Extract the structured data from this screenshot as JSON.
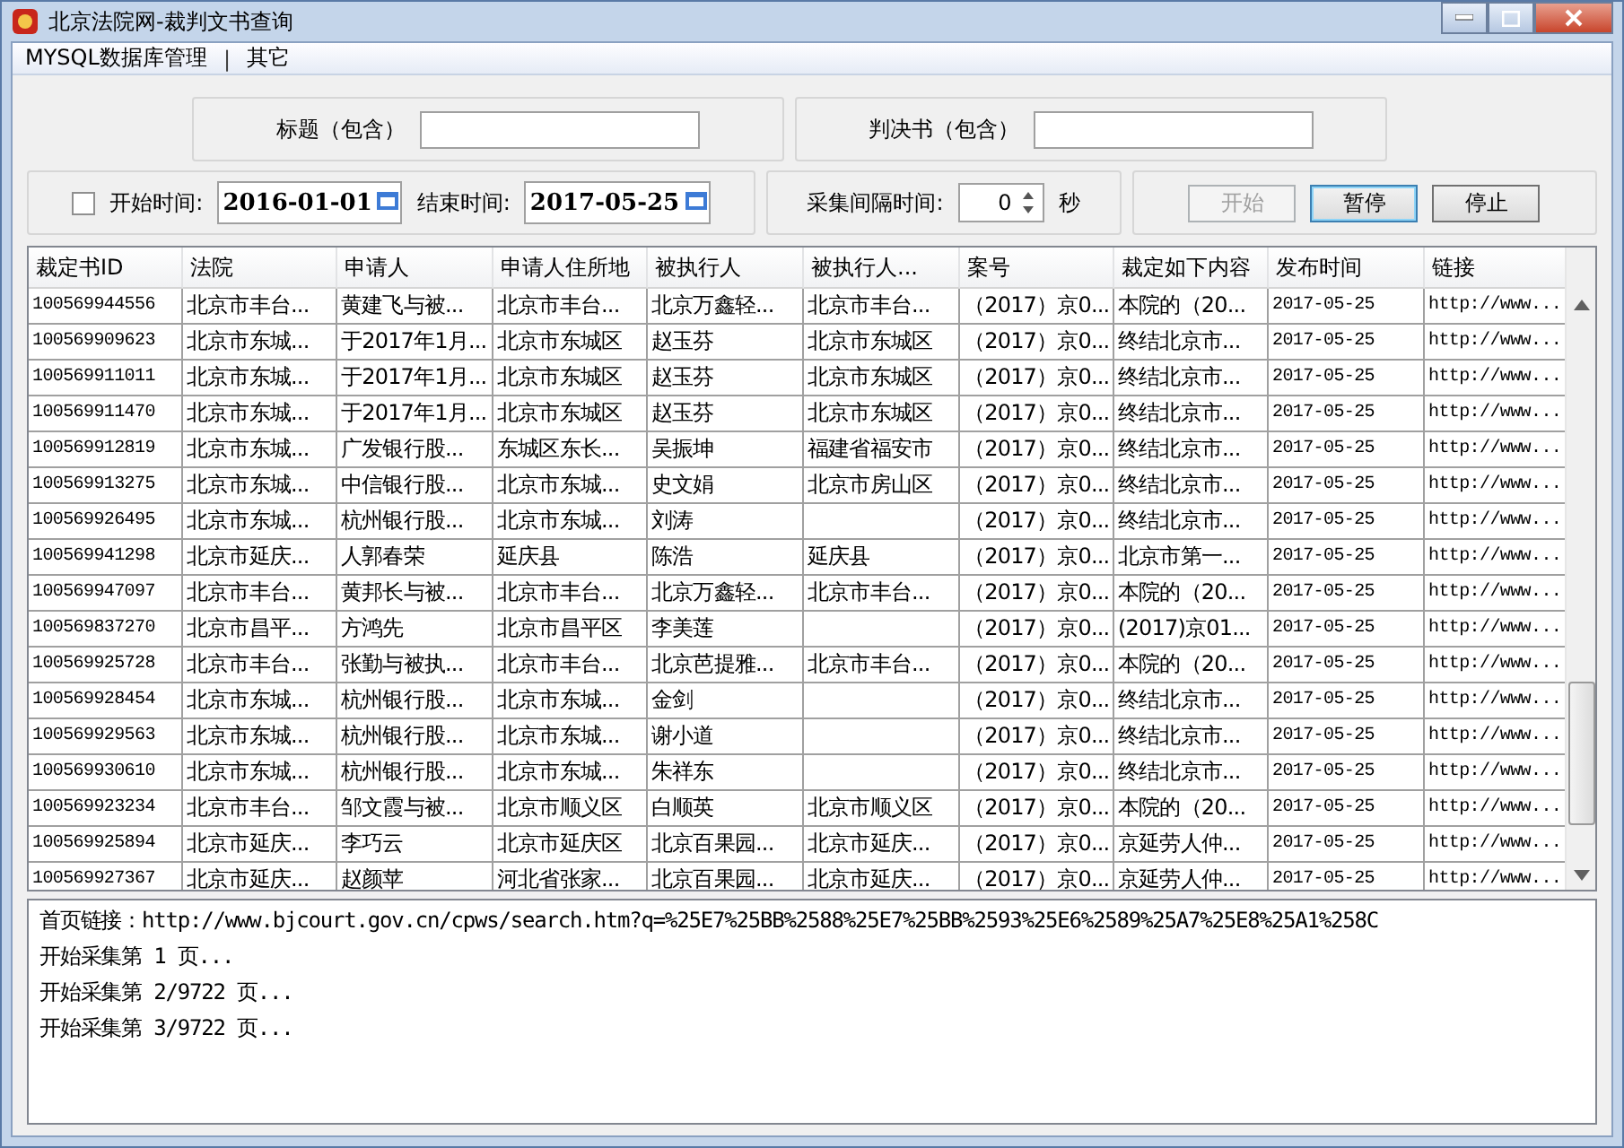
{
  "window": {
    "title": "北京法院网-裁判文书查询"
  },
  "menu": [
    {
      "label": "MYSQL数据库管理",
      "kind": "item"
    },
    {
      "label": "|",
      "kind": "separator"
    },
    {
      "label": "其它",
      "kind": "item"
    }
  ],
  "filters": [
    {
      "label": "标题（包含）"
    },
    {
      "label": "判决书（包含）"
    }
  ],
  "date_range": {
    "enabled": {
      "label": "开始时间:",
      "checked": false
    },
    "start": "2016-01-01",
    "end_label": "结束时间:",
    "end": "2017-05-25"
  },
  "interval": {
    "label": "采集间隔时间:",
    "value": "0",
    "unit": "秒"
  },
  "buttons": [
    {
      "label": "开始",
      "disabled": true,
      "focused": false
    },
    {
      "label": "暂停",
      "disabled": false,
      "focused": true
    },
    {
      "label": "停止",
      "disabled": false,
      "focused": false
    }
  ],
  "table": {
    "columns": [
      "裁定书ID",
      "法院",
      "申请人",
      "申请人住所地",
      "被执行人",
      "被执行人...",
      "案号",
      "裁定如下内容",
      "发布时间",
      "链接"
    ],
    "rows": [
      [
        "100569944556",
        "北京市丰台...",
        "黄建飞与被...",
        "北京市丰台...",
        "北京万鑫轻...",
        "北京市丰台...",
        "（2017）京0...",
        "本院的（20...",
        "2017-05-25",
        "http://www..."
      ],
      [
        "100569909623",
        "北京市东城...",
        "于2017年1月...",
        "北京市东城区",
        "赵玉芬",
        "北京市东城区",
        "（2017）京0...",
        "终结北京市...",
        "2017-05-25",
        "http://www..."
      ],
      [
        "100569911011",
        "北京市东城...",
        "于2017年1月...",
        "北京市东城区",
        "赵玉芬",
        "北京市东城区",
        "（2017）京0...",
        "终结北京市...",
        "2017-05-25",
        "http://www..."
      ],
      [
        "100569911470",
        "北京市东城...",
        "于2017年1月...",
        "北京市东城区",
        "赵玉芬",
        "北京市东城区",
        "（2017）京0...",
        "终结北京市...",
        "2017-05-25",
        "http://www..."
      ],
      [
        "100569912819",
        "北京市东城...",
        "广发银行股...",
        "东城区东长...",
        "吴振坤",
        "福建省福安市",
        "（2017）京0...",
        "终结北京市...",
        "2017-05-25",
        "http://www..."
      ],
      [
        "100569913275",
        "北京市东城...",
        "中信银行股...",
        "北京市东城...",
        "史文娟",
        "北京市房山区",
        "（2017）京0...",
        "终结北京市...",
        "2017-05-25",
        "http://www..."
      ],
      [
        "100569926495",
        "北京市东城...",
        "杭州银行股...",
        "北京市东城...",
        "刘涛",
        null,
        "（2017）京0...",
        "终结北京市...",
        "2017-05-25",
        "http://www..."
      ],
      [
        "100569941298",
        "北京市延庆...",
        "人郭春荣",
        "延庆县",
        "陈浩",
        "延庆县",
        "（2017）京0...",
        "北京市第一...",
        "2017-05-25",
        "http://www..."
      ],
      [
        "100569947097",
        "北京市丰台...",
        "黄邦长与被...",
        "北京市丰台...",
        "北京万鑫轻...",
        "北京市丰台...",
        "（2017）京0...",
        "本院的（20...",
        "2017-05-25",
        "http://www..."
      ],
      [
        "100569837270",
        "北京市昌平...",
        "方鸿先",
        "北京市昌平区",
        "李美莲",
        null,
        "（2017）京0...",
        "(2017)京01...",
        "2017-05-25",
        "http://www..."
      ],
      [
        "100569925728",
        "北京市丰台...",
        "张勤与被执...",
        "北京市丰台...",
        "北京芭提雅...",
        "北京市丰台...",
        "（2017）京0...",
        "本院的（20...",
        "2017-05-25",
        "http://www..."
      ],
      [
        "100569928454",
        "北京市东城...",
        "杭州银行股...",
        "北京市东城...",
        "金剑",
        null,
        "（2017）京0...",
        "终结北京市...",
        "2017-05-25",
        "http://www..."
      ],
      [
        "100569929563",
        "北京市东城...",
        "杭州银行股...",
        "北京市东城...",
        "谢小道",
        null,
        "（2017）京0...",
        "终结北京市...",
        "2017-05-25",
        "http://www..."
      ],
      [
        "100569930610",
        "北京市东城...",
        "杭州银行股...",
        "北京市东城...",
        "朱祥东",
        null,
        "（2017）京0...",
        "终结北京市...",
        "2017-05-25",
        "http://www..."
      ],
      [
        "100569923234",
        "北京市丰台...",
        "邹文霞与被...",
        "北京市顺义区",
        "白顺英",
        "北京市顺义区",
        "（2017）京0...",
        "本院的（20...",
        "2017-05-25",
        "http://www..."
      ],
      [
        "100569925894",
        "北京市延庆...",
        "李巧云",
        "北京市延庆区",
        "北京百果园...",
        "北京市延庆...",
        "（2017）京0...",
        "京延劳人仲...",
        "2017-05-25",
        "http://www..."
      ],
      [
        "100569927367",
        "北京市延庆...",
        "赵颜苹",
        "河北省张家...",
        "北京百果园...",
        "北京市延庆...",
        "（2017）京0...",
        "京延劳人仲...",
        "2017-05-25",
        "http://www..."
      ]
    ]
  },
  "log": [
    "首页链接：http://www.bjcourt.gov.cn/cpws/search.htm?q=%25E7%25BB%2588%25E7%25BB%2593%25E6%2589%25A7%25E8%25A1%258C",
    "开始采集第 1 页...",
    "开始采集第 2/9722 页...",
    "开始采集第 3/9722 页..."
  ]
}
